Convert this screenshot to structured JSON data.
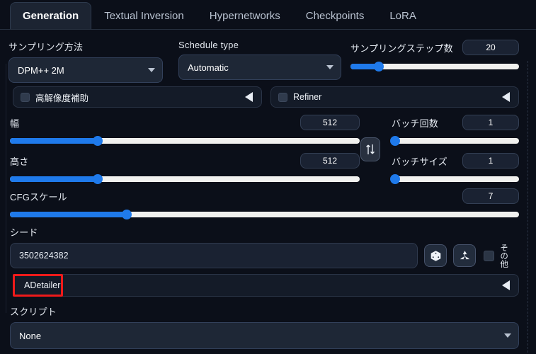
{
  "tabs": [
    {
      "label": "Generation",
      "active": true
    },
    {
      "label": "Textual Inversion",
      "active": false
    },
    {
      "label": "Hypernetworks",
      "active": false
    },
    {
      "label": "Checkpoints",
      "active": false
    },
    {
      "label": "LoRA",
      "active": false
    }
  ],
  "sampling": {
    "method_label": "サンプリング方法",
    "method_value": "DPM++ 2M",
    "schedule_label": "Schedule type",
    "schedule_value": "Automatic",
    "steps_label": "サンプリングステップ数",
    "steps_value": "20"
  },
  "accordions": {
    "hires_label": "高解像度補助",
    "refiner_label": "Refiner"
  },
  "size": {
    "width_label": "幅",
    "width_value": "512",
    "height_label": "高さ",
    "height_value": "512",
    "swap_icon": "swap-arrows-icon"
  },
  "batch": {
    "count_label": "バッチ回数",
    "count_value": "1",
    "size_label": "バッチサイズ",
    "size_value": "1"
  },
  "cfg": {
    "label": "CFGスケール",
    "value": "7"
  },
  "seed": {
    "label": "シード",
    "value": "3502624382",
    "dice_icon": "dice-icon",
    "recycle_icon": "recycle-icon",
    "extra_label": "その他"
  },
  "adetailer": {
    "label": "ADetailer",
    "highlight_color": "#ef1a1a"
  },
  "script": {
    "label": "スクリプト",
    "value": "None"
  },
  "colors": {
    "accent": "#1f7aeb",
    "background": "#0b0f19",
    "panel": "#1c2432",
    "track": "#f1f1ef",
    "highlight": "#ef1a1a"
  }
}
